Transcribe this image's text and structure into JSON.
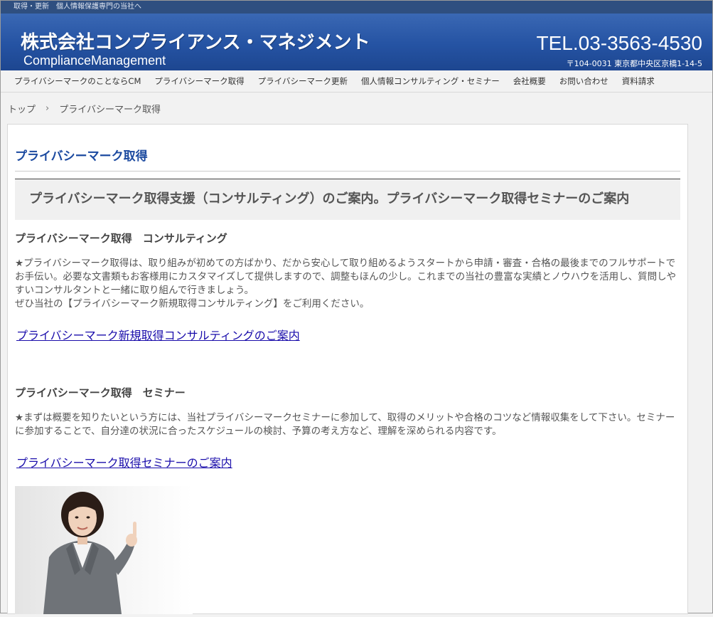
{
  "topbar": {
    "text": "取得・更新　個人情報保護専門の当社へ"
  },
  "header": {
    "company": "株式会社コンプライアンス・マネジメント",
    "company_en": "ComplianceManagement",
    "tel": "TEL.03-3563-4530",
    "address": "〒104-0031 東京都中央区京橋1-14-5"
  },
  "nav": {
    "items": [
      "プライバシーマークのことならCM",
      "プライバシーマーク取得",
      "プライバシーマーク更新",
      "個人情報コンサルティング・セミナー",
      "会社概要",
      "お問い合わせ",
      "資料請求"
    ]
  },
  "breadcrumb": {
    "home": "トップ",
    "sep": "›",
    "current": "プライバシーマーク取得"
  },
  "content": {
    "title": "プライバシーマーク取得",
    "h2": "プライバシーマーク取得支援（コンサルティング）のご案内。プライバシーマーク取得セミナーのご案内",
    "sections": [
      {
        "heading": "プライバシーマーク取得　コンサルティング",
        "body": "★プライバシーマーク取得は、取り組みが初めての方ばかり、だから安心して取り組めるようスタートから申請・審査・合格の最後までのフルサポートでお手伝い。必要な文書類もお客様用にカスタマイズして提供しますので、調整もほんの少し。これまでの当社の豊富な実績とノウハウを活用し、質問しやすいコンサルタントと一緒に取り組んで行きましょう。",
        "body2": "ぜひ当社の【プライバシーマーク新規取得コンサルティング】をご利用ください。",
        "link": "プライバシーマーク新規取得コンサルティングのご案内"
      },
      {
        "heading": "プライバシーマーク取得　セミナー",
        "body": "★まずは概要を知りたいという方には、当社プライバシーマークセミナーに参加して、取得のメリットや合格のコツなど情報収集をして下さい。セミナーに参加することで、自分達の状況に合ったスケジュールの検討、予算の考え方など、理解を深められる内容です。",
        "link": "プライバシーマーク取得セミナーのご案内"
      }
    ]
  },
  "colors": {
    "header_blue": "#2553a3",
    "title_blue": "#1c4aa0",
    "link": "#1a0dab"
  }
}
